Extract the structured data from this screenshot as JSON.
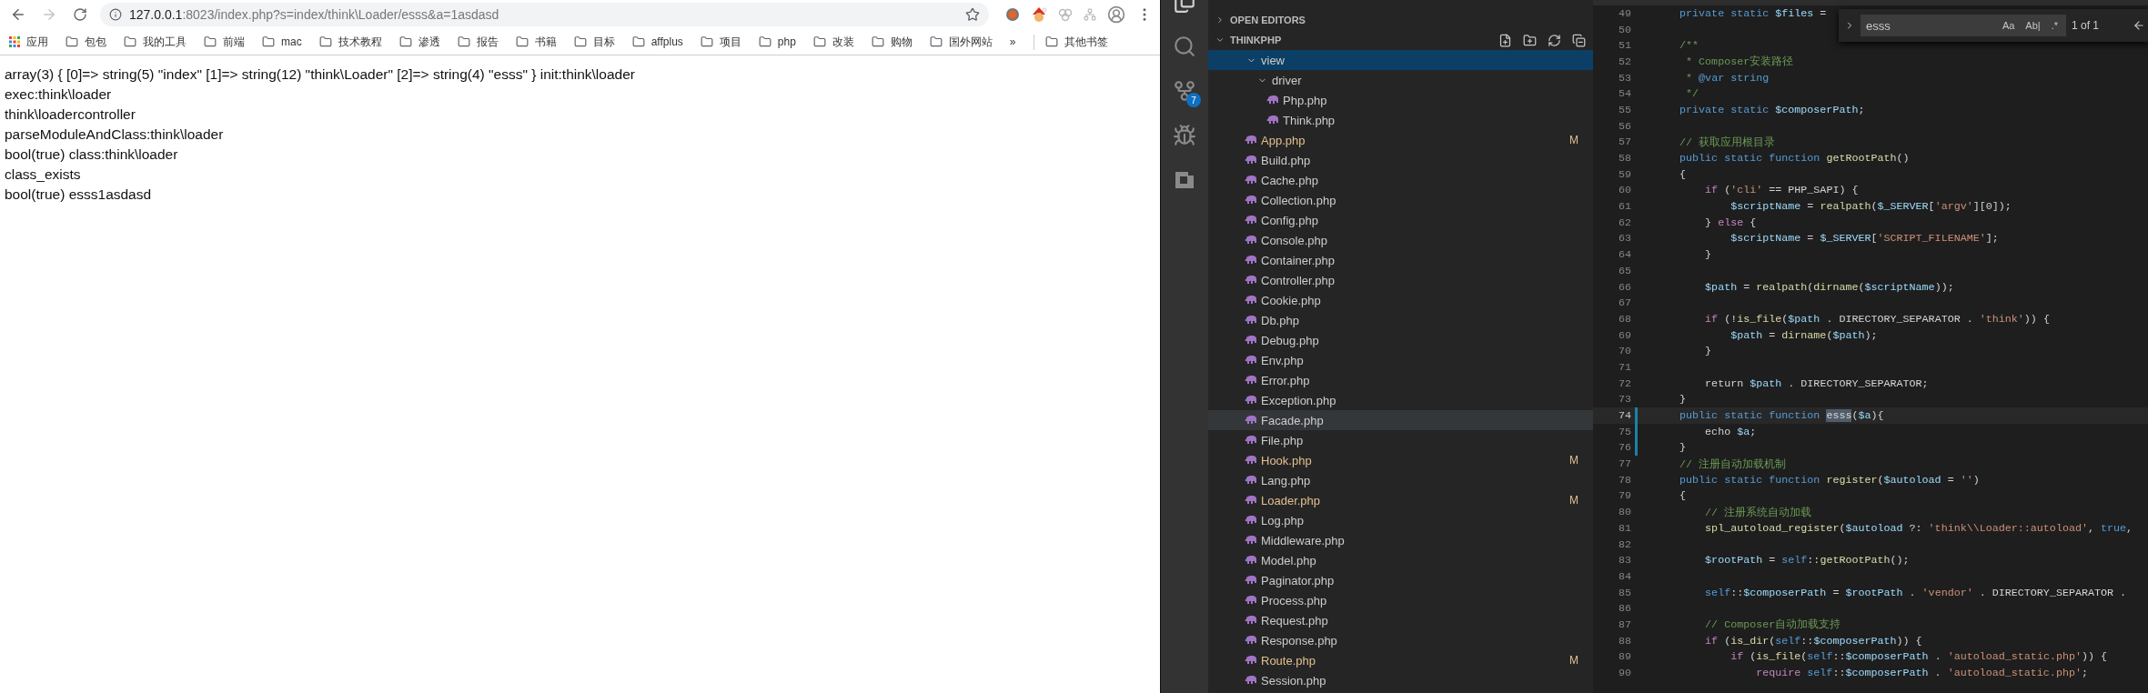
{
  "browser": {
    "address": {
      "host": "127.0.0.1",
      "path": ":8023/index.php?s=index/think\\Loader/esss&a=1asdasd"
    },
    "forward": {
      "disabled": true
    },
    "bookmarks": [
      {
        "label": "应用",
        "kind": "apps"
      },
      {
        "label": "包包",
        "kind": "folder"
      },
      {
        "label": "我的工具",
        "kind": "folder"
      },
      {
        "label": "前端",
        "kind": "folder"
      },
      {
        "label": "mac",
        "kind": "folder"
      },
      {
        "label": "技术教程",
        "kind": "folder"
      },
      {
        "label": "渗透",
        "kind": "folder"
      },
      {
        "label": "报告",
        "kind": "folder"
      },
      {
        "label": "书籍",
        "kind": "folder"
      },
      {
        "label": "目标",
        "kind": "folder"
      },
      {
        "label": "affplus",
        "kind": "folder"
      },
      {
        "label": "项目",
        "kind": "folder"
      },
      {
        "label": "php",
        "kind": "folder"
      },
      {
        "label": "改装",
        "kind": "folder"
      },
      {
        "label": "购物",
        "kind": "folder"
      },
      {
        "label": "国外网站",
        "kind": "folder"
      },
      {
        "label": "»",
        "kind": "overflow"
      },
      {
        "label": "其他书签",
        "kind": "folder"
      }
    ],
    "page_output": [
      "array(3) { [0]=> string(5) \"index\" [1]=> string(12) \"think\\Loader\" [2]=> string(4) \"esss\" } init:think\\loader",
      "exec:think\\loader",
      "think\\loadercontroller",
      "parseModuleAndClass:think\\loader",
      "bool(true) class:think\\loader",
      "class_exists",
      "bool(true) esss1asdasd"
    ]
  },
  "vscode": {
    "activity_bar": {
      "scm_badge": "7"
    },
    "sidebar": {
      "sections": [
        {
          "title": "OPEN EDITORS",
          "expanded": false
        },
        {
          "title": "THINKPHP",
          "expanded": true
        }
      ],
      "tree": [
        {
          "name": "view",
          "kind": "folder",
          "expanded": true,
          "selected": true,
          "children": [
            {
              "name": "driver",
              "kind": "folder",
              "expanded": true,
              "selected": false,
              "children": [
                {
                  "name": "Php.php",
                  "kind": "file",
                  "selected": false,
                  "modified": false,
                  "hovered": false
                },
                {
                  "name": "Think.php",
                  "kind": "file",
                  "selected": false,
                  "modified": false,
                  "hovered": false
                }
              ]
            }
          ]
        },
        {
          "name": "App.php",
          "kind": "file",
          "selected": false,
          "modified": true,
          "hovered": false,
          "badge": "M"
        },
        {
          "name": "Build.php",
          "kind": "file",
          "selected": false,
          "modified": false,
          "hovered": false
        },
        {
          "name": "Cache.php",
          "kind": "file",
          "selected": false,
          "modified": false,
          "hovered": false
        },
        {
          "name": "Collection.php",
          "kind": "file",
          "selected": false,
          "modified": false,
          "hovered": false
        },
        {
          "name": "Config.php",
          "kind": "file",
          "selected": false,
          "modified": false,
          "hovered": false
        },
        {
          "name": "Console.php",
          "kind": "file",
          "selected": false,
          "modified": false,
          "hovered": false
        },
        {
          "name": "Container.php",
          "kind": "file",
          "selected": false,
          "modified": false,
          "hovered": false
        },
        {
          "name": "Controller.php",
          "kind": "file",
          "selected": false,
          "modified": false,
          "hovered": false
        },
        {
          "name": "Cookie.php",
          "kind": "file",
          "selected": false,
          "modified": false,
          "hovered": false
        },
        {
          "name": "Db.php",
          "kind": "file",
          "selected": false,
          "modified": false,
          "hovered": false
        },
        {
          "name": "Debug.php",
          "kind": "file",
          "selected": false,
          "modified": false,
          "hovered": false
        },
        {
          "name": "Env.php",
          "kind": "file",
          "selected": false,
          "modified": false,
          "hovered": false
        },
        {
          "name": "Error.php",
          "kind": "file",
          "selected": false,
          "modified": false,
          "hovered": false
        },
        {
          "name": "Exception.php",
          "kind": "file",
          "selected": false,
          "modified": false,
          "hovered": false
        },
        {
          "name": "Facade.php",
          "kind": "file",
          "selected": false,
          "modified": false,
          "hovered": true
        },
        {
          "name": "File.php",
          "kind": "file",
          "selected": false,
          "modified": false,
          "hovered": false
        },
        {
          "name": "Hook.php",
          "kind": "file",
          "selected": false,
          "modified": true,
          "hovered": false,
          "badge": "M"
        },
        {
          "name": "Lang.php",
          "kind": "file",
          "selected": false,
          "modified": false,
          "hovered": false
        },
        {
          "name": "Loader.php",
          "kind": "file",
          "selected": false,
          "modified": true,
          "hovered": false,
          "badge": "M"
        },
        {
          "name": "Log.php",
          "kind": "file",
          "selected": false,
          "modified": false,
          "hovered": false
        },
        {
          "name": "Middleware.php",
          "kind": "file",
          "selected": false,
          "modified": false,
          "hovered": false
        },
        {
          "name": "Model.php",
          "kind": "file",
          "selected": false,
          "modified": false,
          "hovered": false
        },
        {
          "name": "Paginator.php",
          "kind": "file",
          "selected": false,
          "modified": false,
          "hovered": false
        },
        {
          "name": "Process.php",
          "kind": "file",
          "selected": false,
          "modified": false,
          "hovered": false
        },
        {
          "name": "Request.php",
          "kind": "file",
          "selected": false,
          "modified": false,
          "hovered": false
        },
        {
          "name": "Response.php",
          "kind": "file",
          "selected": false,
          "modified": false,
          "hovered": false
        },
        {
          "name": "Route.php",
          "kind": "file",
          "selected": false,
          "modified": true,
          "hovered": false,
          "badge": "M"
        },
        {
          "name": "Session.php",
          "kind": "file",
          "selected": false,
          "modified": false,
          "hovered": false
        }
      ]
    },
    "find_widget": {
      "query": "esss",
      "options": [
        {
          "label": "Aa",
          "selected": false
        },
        {
          "label": "Ab|",
          "selected": false
        },
        {
          "label": ".*",
          "selected": false
        }
      ],
      "count": "1 of 1"
    },
    "editor": {
      "lines": [
        {
          "num": "49",
          "current": false,
          "changed": false,
          "tokens": [
            {
              "text": "    private static ",
              "kind": "kw"
            },
            {
              "text": "$files",
              "kind": "var"
            },
            {
              "text": " =",
              "kind": "plain"
            }
          ]
        },
        {
          "num": "50",
          "current": false,
          "changed": false
        },
        {
          "num": "51",
          "current": false,
          "changed": false,
          "tokens": [
            {
              "text": "    /**",
              "kind": "comment"
            }
          ]
        },
        {
          "num": "52",
          "current": false,
          "changed": false,
          "tokens": [
            {
              "text": "     * Composer安装路径",
              "kind": "comment"
            }
          ]
        },
        {
          "num": "53",
          "current": false,
          "changed": false,
          "tokens": [
            {
              "text": "     * ",
              "kind": "comment"
            },
            {
              "text": "@var string",
              "kind": "kw"
            }
          ]
        },
        {
          "num": "54",
          "current": false,
          "changed": false,
          "tokens": [
            {
              "text": "     */",
              "kind": "comment"
            }
          ]
        },
        {
          "num": "55",
          "current": false,
          "changed": false,
          "tokens": [
            {
              "text": "    private static ",
              "kind": "kw"
            },
            {
              "text": "$composerPath",
              "kind": "var"
            },
            {
              "text": ";",
              "kind": "plain"
            }
          ]
        },
        {
          "num": "56",
          "current": false,
          "changed": false
        },
        {
          "num": "57",
          "current": false,
          "changed": false,
          "tokens": [
            {
              "text": "    // 获取应用根目录",
              "kind": "comment"
            }
          ]
        },
        {
          "num": "58",
          "current": false,
          "changed": false,
          "tokens": [
            {
              "text": "    public static function ",
              "kind": "kw"
            },
            {
              "text": "getRootPath",
              "kind": "fn"
            },
            {
              "text": "()",
              "kind": "plain"
            }
          ]
        },
        {
          "num": "59",
          "current": false,
          "changed": false,
          "tokens": [
            {
              "text": "    {",
              "kind": "plain"
            }
          ]
        },
        {
          "num": "60",
          "current": false,
          "changed": false,
          "tokens": [
            {
              "text": "        if",
              "kind": "ctl"
            },
            {
              "text": " (",
              "kind": "plain"
            },
            {
              "text": "'cli'",
              "kind": "str"
            },
            {
              "text": " == PHP_SAPI) {",
              "kind": "plain"
            }
          ]
        },
        {
          "num": "61",
          "current": false,
          "changed": false,
          "tokens": [
            {
              "text": "            $scriptName",
              "kind": "var"
            },
            {
              "text": " = ",
              "kind": "plain"
            },
            {
              "text": "realpath",
              "kind": "fn"
            },
            {
              "text": "(",
              "kind": "plain"
            },
            {
              "text": "$_SERVER",
              "kind": "var"
            },
            {
              "text": "[",
              "kind": "plain"
            },
            {
              "text": "'argv'",
              "kind": "str"
            },
            {
              "text": "][0]);",
              "kind": "plain"
            }
          ]
        },
        {
          "num": "62",
          "current": false,
          "changed": false,
          "tokens": [
            {
              "text": "        } ",
              "kind": "plain"
            },
            {
              "text": "else",
              "kind": "ctl"
            },
            {
              "text": " {",
              "kind": "plain"
            }
          ]
        },
        {
          "num": "63",
          "current": false,
          "changed": false,
          "tokens": [
            {
              "text": "            $scriptName",
              "kind": "var"
            },
            {
              "text": " = ",
              "kind": "plain"
            },
            {
              "text": "$_SERVER",
              "kind": "var"
            },
            {
              "text": "[",
              "kind": "plain"
            },
            {
              "text": "'SCRIPT_FILENAME'",
              "kind": "str"
            },
            {
              "text": "];",
              "kind": "plain"
            }
          ]
        },
        {
          "num": "64",
          "current": false,
          "changed": false,
          "tokens": [
            {
              "text": "        }",
              "kind": "plain"
            }
          ]
        },
        {
          "num": "65",
          "current": false,
          "changed": false
        },
        {
          "num": "66",
          "current": false,
          "changed": false,
          "tokens": [
            {
              "text": "        $path",
              "kind": "var"
            },
            {
              "text": " = ",
              "kind": "plain"
            },
            {
              "text": "realpath",
              "kind": "fn"
            },
            {
              "text": "(",
              "kind": "plain"
            },
            {
              "text": "dirname",
              "kind": "fn"
            },
            {
              "text": "(",
              "kind": "plain"
            },
            {
              "text": "$scriptName",
              "kind": "var"
            },
            {
              "text": "));",
              "kind": "plain"
            }
          ]
        },
        {
          "num": "67",
          "current": false,
          "changed": false
        },
        {
          "num": "68",
          "current": false,
          "changed": false,
          "tokens": [
            {
              "text": "        if",
              "kind": "ctl"
            },
            {
              "text": " (!",
              "kind": "plain"
            },
            {
              "text": "is_file",
              "kind": "fn"
            },
            {
              "text": "(",
              "kind": "plain"
            },
            {
              "text": "$path",
              "kind": "var"
            },
            {
              "text": " . DIRECTORY_SEPARATOR . ",
              "kind": "plain"
            },
            {
              "text": "'think'",
              "kind": "str"
            },
            {
              "text": ")) {",
              "kind": "plain"
            }
          ]
        },
        {
          "num": "69",
          "current": false,
          "changed": false,
          "tokens": [
            {
              "text": "            $path",
              "kind": "var"
            },
            {
              "text": " = ",
              "kind": "plain"
            },
            {
              "text": "dirname",
              "kind": "fn"
            },
            {
              "text": "(",
              "kind": "plain"
            },
            {
              "text": "$path",
              "kind": "var"
            },
            {
              "text": ");",
              "kind": "plain"
            }
          ]
        },
        {
          "num": "70",
          "current": false,
          "changed": false,
          "tokens": [
            {
              "text": "        }",
              "kind": "plain"
            }
          ]
        },
        {
          "num": "71",
          "current": false,
          "changed": false
        },
        {
          "num": "72",
          "current": false,
          "changed": false,
          "tokens": [
            {
              "text": "        return ",
              "kind": "plain"
            },
            {
              "text": "$path",
              "kind": "var"
            },
            {
              "text": " . DIRECTORY_SEPARATOR;",
              "kind": "plain"
            }
          ]
        },
        {
          "num": "73",
          "current": false,
          "changed": false,
          "tokens": [
            {
              "text": "    }",
              "kind": "plain"
            }
          ]
        },
        {
          "num": "74",
          "current": true,
          "changed": true,
          "tokens": [
            {
              "text": "    public static function ",
              "kind": "kw"
            },
            {
              "text": "esss",
              "kind": "match"
            },
            {
              "text": "(",
              "kind": "plain"
            },
            {
              "text": "$a",
              "kind": "var"
            },
            {
              "text": "){",
              "kind": "plain"
            }
          ]
        },
        {
          "num": "75",
          "current": false,
          "changed": true,
          "tokens": [
            {
              "text": "        echo ",
              "kind": "plain"
            },
            {
              "text": "$a",
              "kind": "var"
            },
            {
              "text": ";",
              "kind": "plain"
            }
          ]
        },
        {
          "num": "76",
          "current": false,
          "changed": true,
          "tokens": [
            {
              "text": "    }",
              "kind": "plain"
            }
          ]
        },
        {
          "num": "77",
          "current": false,
          "changed": false,
          "tokens": [
            {
              "text": "    // 注册自动加载机制",
              "kind": "comment"
            }
          ]
        },
        {
          "num": "78",
          "current": false,
          "changed": false,
          "tokens": [
            {
              "text": "    public static function ",
              "kind": "kw"
            },
            {
              "text": "register",
              "kind": "fn"
            },
            {
              "text": "(",
              "kind": "plain"
            },
            {
              "text": "$autoload",
              "kind": "var"
            },
            {
              "text": " = ",
              "kind": "plain"
            },
            {
              "text": "''",
              "kind": "str"
            },
            {
              "text": ")",
              "kind": "plain"
            }
          ]
        },
        {
          "num": "79",
          "current": false,
          "changed": false,
          "tokens": [
            {
              "text": "    {",
              "kind": "plain"
            }
          ]
        },
        {
          "num": "80",
          "current": false,
          "changed": false,
          "tokens": [
            {
              "text": "        // 注册系统自动加载",
              "kind": "comment"
            }
          ]
        },
        {
          "num": "81",
          "current": false,
          "changed": false,
          "tokens": [
            {
              "text": "        spl_autoload_register",
              "kind": "fn"
            },
            {
              "text": "(",
              "kind": "plain"
            },
            {
              "text": "$autoload",
              "kind": "var"
            },
            {
              "text": " ?: ",
              "kind": "plain"
            },
            {
              "text": "'think\\\\Loader::autoload'",
              "kind": "str"
            },
            {
              "text": ", ",
              "kind": "plain"
            },
            {
              "text": "true",
              "kind": "kw"
            },
            {
              "text": ",",
              "kind": "plain"
            }
          ]
        },
        {
          "num": "82",
          "current": false,
          "changed": false
        },
        {
          "num": "83",
          "current": false,
          "changed": false,
          "tokens": [
            {
              "text": "        $rootPath",
              "kind": "var"
            },
            {
              "text": " = ",
              "kind": "plain"
            },
            {
              "text": "self",
              "kind": "kw"
            },
            {
              "text": "::",
              "kind": "plain"
            },
            {
              "text": "getRootPath",
              "kind": "fn"
            },
            {
              "text": "();",
              "kind": "plain"
            }
          ]
        },
        {
          "num": "84",
          "current": false,
          "changed": false
        },
        {
          "num": "85",
          "current": false,
          "changed": false,
          "tokens": [
            {
              "text": "        self",
              "kind": "kw"
            },
            {
              "text": "::",
              "kind": "plain"
            },
            {
              "text": "$composerPath",
              "kind": "var"
            },
            {
              "text": " = ",
              "kind": "plain"
            },
            {
              "text": "$rootPath",
              "kind": "var"
            },
            {
              "text": " . ",
              "kind": "plain"
            },
            {
              "text": "'vendor'",
              "kind": "str"
            },
            {
              "text": " . DIRECTORY_SEPARATOR .",
              "kind": "plain"
            }
          ]
        },
        {
          "num": "86",
          "current": false,
          "changed": false
        },
        {
          "num": "87",
          "current": false,
          "changed": false,
          "tokens": [
            {
              "text": "        // Composer自动加载支持",
              "kind": "comment"
            }
          ]
        },
        {
          "num": "88",
          "current": false,
          "changed": false,
          "tokens": [
            {
              "text": "        if",
              "kind": "ctl"
            },
            {
              "text": " (",
              "kind": "plain"
            },
            {
              "text": "is_dir",
              "kind": "fn"
            },
            {
              "text": "(",
              "kind": "plain"
            },
            {
              "text": "self",
              "kind": "kw"
            },
            {
              "text": "::",
              "kind": "plain"
            },
            {
              "text": "$composerPath",
              "kind": "var"
            },
            {
              "text": ")) {",
              "kind": "plain"
            }
          ]
        },
        {
          "num": "89",
          "current": false,
          "changed": false,
          "tokens": [
            {
              "text": "            if",
              "kind": "ctl"
            },
            {
              "text": " (",
              "kind": "plain"
            },
            {
              "text": "is_file",
              "kind": "fn"
            },
            {
              "text": "(",
              "kind": "plain"
            },
            {
              "text": "self",
              "kind": "kw"
            },
            {
              "text": "::",
              "kind": "plain"
            },
            {
              "text": "$composerPath",
              "kind": "var"
            },
            {
              "text": " . ",
              "kind": "plain"
            },
            {
              "text": "'autoload_static.php'",
              "kind": "str"
            },
            {
              "text": ")) {",
              "kind": "plain"
            }
          ]
        },
        {
          "num": "90",
          "current": false,
          "changed": false,
          "tokens": [
            {
              "text": "                require ",
              "kind": "ctl"
            },
            {
              "text": "self",
              "kind": "kw"
            },
            {
              "text": "::",
              "kind": "plain"
            },
            {
              "text": "$composerPath",
              "kind": "var"
            },
            {
              "text": " . ",
              "kind": "plain"
            },
            {
              "text": "'autoload_static.php'",
              "kind": "str"
            },
            {
              "text": ";",
              "kind": "plain"
            }
          ]
        }
      ]
    }
  }
}
